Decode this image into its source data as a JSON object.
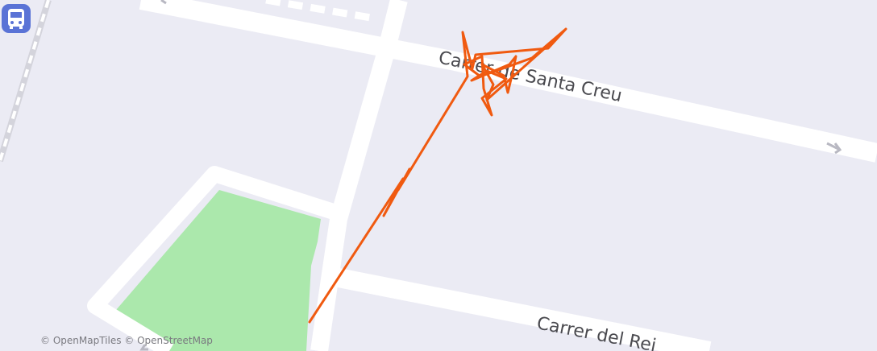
{
  "map": {
    "colors": {
      "background": "#ebebf4",
      "road": "#ffffff",
      "park": "#abe8ac",
      "route": "#f05a10",
      "bus_stop": "#5a73d6",
      "label": "#4a4a4f"
    },
    "street_labels": [
      {
        "id": "carrer-santa-creu",
        "text": "Carrer de Santa Creu"
      },
      {
        "id": "carrer-del-rei",
        "text": "Carrer del Rei"
      }
    ],
    "poi": {
      "icon": "bus-icon",
      "type": "bus-stop"
    },
    "attribution": "© OpenMapTiles © OpenStreetMap"
  }
}
